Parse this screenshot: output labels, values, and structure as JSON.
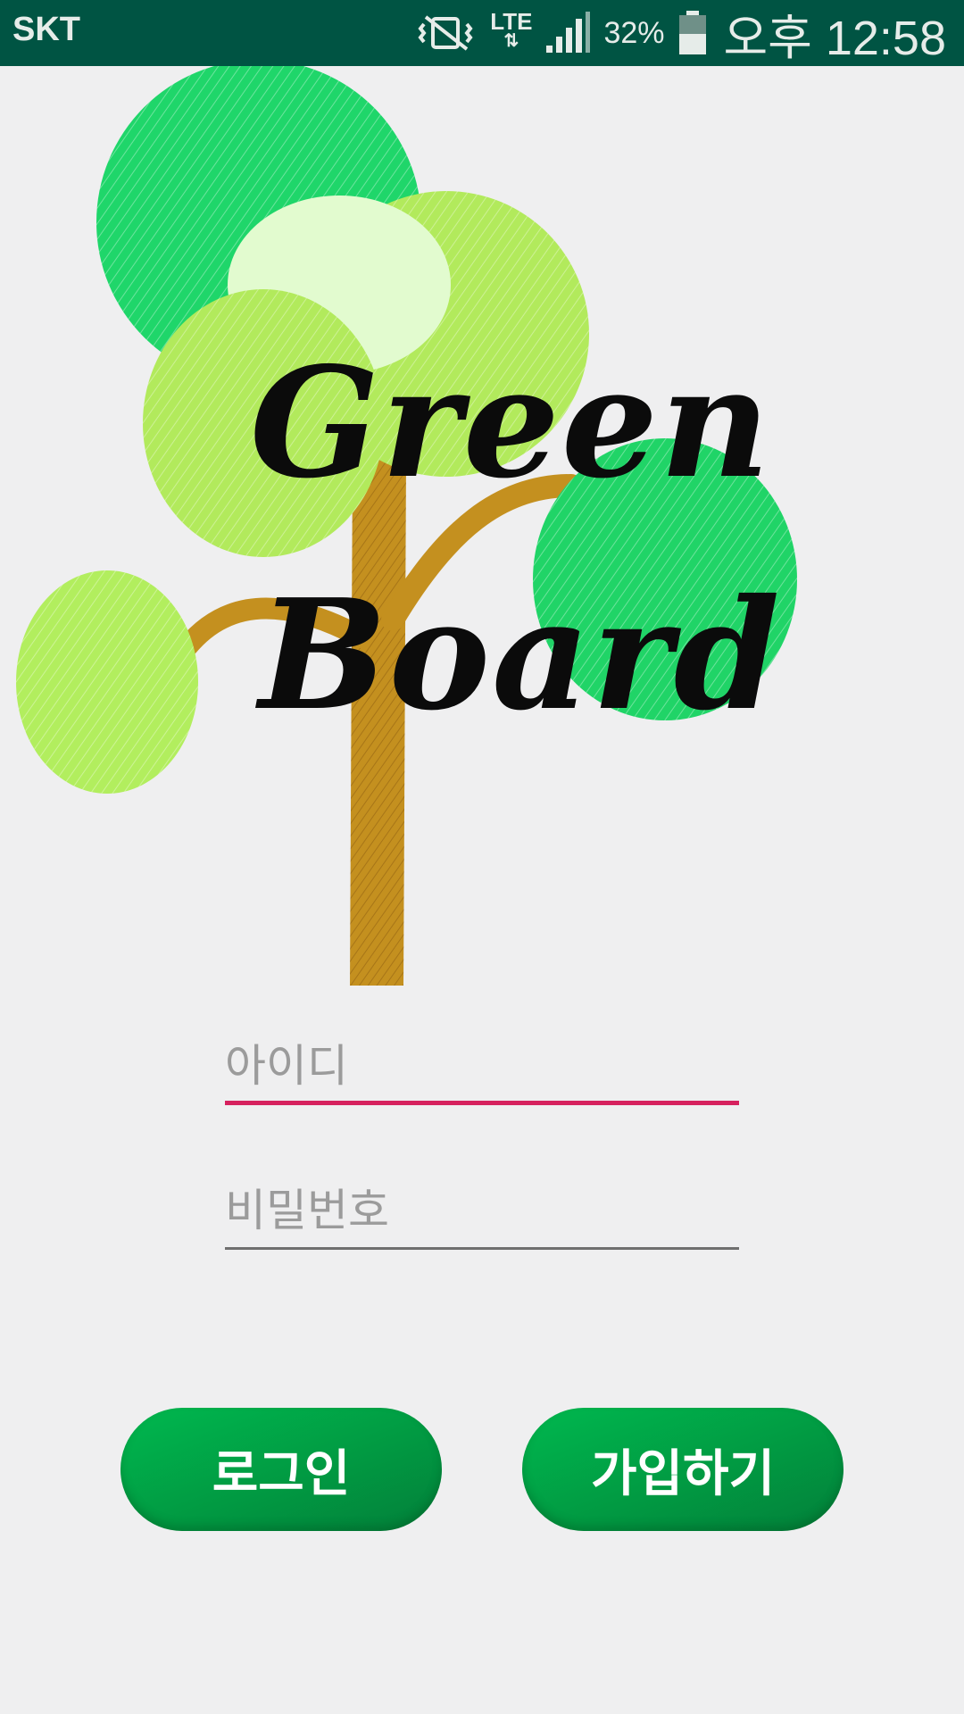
{
  "status_bar": {
    "carrier": "SKT",
    "network": "LTE",
    "battery_percent": "32%",
    "time": "오후 12:58",
    "icons": [
      "vibrate-mute-icon",
      "lte-data-icon",
      "signal-icon",
      "battery-icon"
    ],
    "background_color": "#005443"
  },
  "logo": {
    "line1": "Green",
    "line2": "Board",
    "image": "tree-illustration"
  },
  "form": {
    "id_placeholder": "아이디",
    "id_value": "",
    "password_placeholder": "비밀번호",
    "password_value": "",
    "focused_underline_color": "#d6215e"
  },
  "buttons": {
    "login_label": "로그인",
    "signup_label": "가입하기",
    "button_color": "#00a84a"
  }
}
